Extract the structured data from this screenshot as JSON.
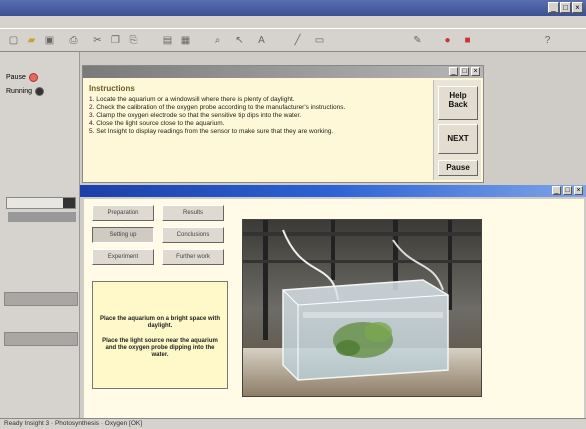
{
  "app": {
    "title_text": ""
  },
  "left_panel": {
    "radios": [
      {
        "label": "Pause",
        "state": "red"
      },
      {
        "label": "Running",
        "state": "on"
      }
    ]
  },
  "instructions": {
    "heading": "Instructions",
    "steps": [
      "1. Locate the aquarium or a windowsill where there is plenty of daylight.",
      "2. Check the calibration of the oxygen probe according to the manufacturer's instructions.",
      "3. Clamp the oxygen electrode so that the sensitive tip dips into the water.",
      "4. Close the light source close to the aquarium.",
      "5. Set Insight to display readings from the sensor to make sure that they are working."
    ],
    "buttons": {
      "help": "Help",
      "back": "Back",
      "next": "NEXT",
      "pause": "Pause"
    }
  },
  "experiment": {
    "buttons": [
      {
        "label": "Preparation"
      },
      {
        "label": "Results"
      },
      {
        "label": "Setting up"
      },
      {
        "label": "Conclusions"
      },
      {
        "label": "Experiment"
      },
      {
        "label": "Further work"
      }
    ],
    "message_1": "Place the aquarium on a bright space with daylight.",
    "message_2": "Place the light source near the aquarium and the oxygen probe dipping into the water."
  },
  "status": {
    "text": "Ready  Insight 3  ·  Photosynthesis  ·  Oxygen  [OK]"
  },
  "colors": {
    "title_active": "#2c63d6",
    "instruction_bg": "#fff8d8",
    "message_bg": "#fff8c8"
  }
}
